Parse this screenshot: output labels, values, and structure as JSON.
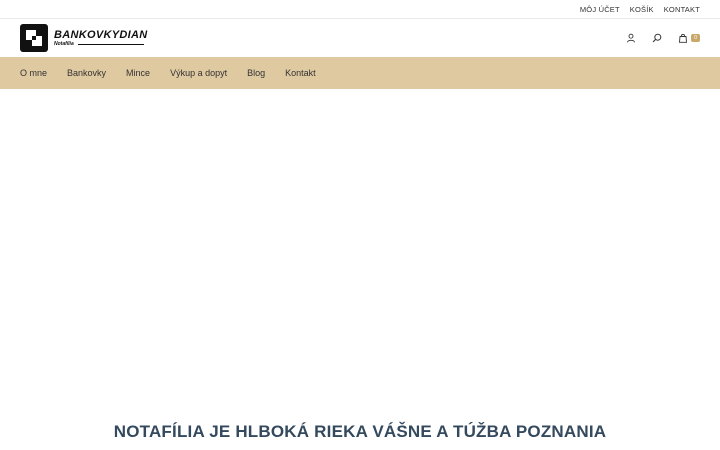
{
  "top_links": [
    "MÔJ ÚČET",
    "KOŠÍK",
    "KONTAKT"
  ],
  "logo": {
    "name": "BANKOVKYDIAN",
    "tagline": "Notafília"
  },
  "cart": {
    "count": "0"
  },
  "nav": [
    "O mne",
    "Bankovky",
    "Mince",
    "Výkup a dopyt",
    "Blog",
    "Kontakt"
  ],
  "headline": "NOTAFÍLIA JE HLBOKÁ RIEKA VÁŠNE A TÚŽBA POZNANIA",
  "colors": {
    "nav_bg": "#dfc9a0",
    "badge": "#c8a96a",
    "headline": "#34495e"
  },
  "icons": [
    "user-icon",
    "search-icon",
    "shopping-bag-icon"
  ]
}
